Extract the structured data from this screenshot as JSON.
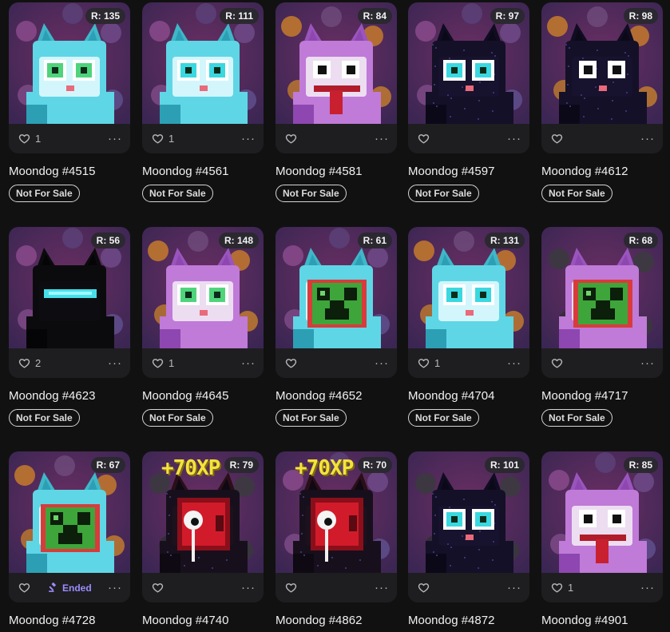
{
  "colors": {
    "page_bg": "#111112",
    "card_bg": "#1e1e20",
    "accent_ended": "#9c8cff"
  },
  "labels": {
    "more": "···"
  },
  "items": [
    {
      "name": "Moondog #4515",
      "rank": "R: 135",
      "likes": "1",
      "status": "Not For Sale",
      "variant": "cyan",
      "eyes": "green",
      "bg": "purple"
    },
    {
      "name": "Moondog #4561",
      "rank": "R: 111",
      "likes": "1",
      "status": "Not For Sale",
      "variant": "cyan",
      "eyes": "cyan",
      "bg": "purple"
    },
    {
      "name": "Moondog #4581",
      "rank": "R: 84",
      "likes": "",
      "status": "Not For Sale",
      "variant": "white",
      "eyes": "white",
      "bg": "orange",
      "tongue": true
    },
    {
      "name": "Moondog #4597",
      "rank": "R: 97",
      "likes": "",
      "status": "Not For Sale",
      "variant": "black",
      "eyes": "cyan",
      "bg": "purple"
    },
    {
      "name": "Moondog #4612",
      "rank": "R: 98",
      "likes": "",
      "status": "Not For Sale",
      "variant": "black",
      "eyes": "white",
      "bg": "orange"
    },
    {
      "name": "Moondog #4623",
      "rank": "R: 56",
      "likes": "2",
      "status": "Not For Sale",
      "variant": "blackvisor",
      "eyes": "visor",
      "bg": "purple"
    },
    {
      "name": "Moondog #4645",
      "rank": "R: 148",
      "likes": "1",
      "status": "Not For Sale",
      "variant": "white",
      "eyes": "green",
      "bg": "orange"
    },
    {
      "name": "Moondog #4652",
      "rank": "R: 61",
      "likes": "",
      "status": "Not For Sale",
      "variant": "cyan",
      "eyes": "creeper",
      "bg": "purple"
    },
    {
      "name": "Moondog #4704",
      "rank": "R: 131",
      "likes": "1",
      "status": "Not For Sale",
      "variant": "cyan",
      "eyes": "cyan",
      "bg": "orange"
    },
    {
      "name": "Moondog #4717",
      "rank": "R: 68",
      "likes": "",
      "status": "Not For Sale",
      "variant": "white",
      "eyes": "creeper",
      "bg": "dark"
    },
    {
      "name": "Moondog #4728",
      "rank": "R: 67",
      "likes": "",
      "ended": "Ended",
      "variant": "cyan",
      "eyes": "creeper",
      "bg": "orange"
    },
    {
      "name": "Moondog #4740",
      "rank": "R: 79",
      "likes": "",
      "overlay": "+70XP",
      "variant": "bloody",
      "eyes": "bloody",
      "bg": "dark"
    },
    {
      "name": "Moondog #4862",
      "rank": "R: 70",
      "likes": "",
      "overlay": "+70XP",
      "variant": "bloody",
      "eyes": "bloody",
      "bg": "purple"
    },
    {
      "name": "Moondog #4872",
      "rank": "R: 101",
      "likes": "",
      "variant": "black",
      "eyes": "cyan",
      "bg": "dark"
    },
    {
      "name": "Moondog #4901",
      "rank": "R: 85",
      "likes": "1",
      "variant": "white",
      "eyes": "white",
      "bg": "purple",
      "tongue": true
    }
  ]
}
